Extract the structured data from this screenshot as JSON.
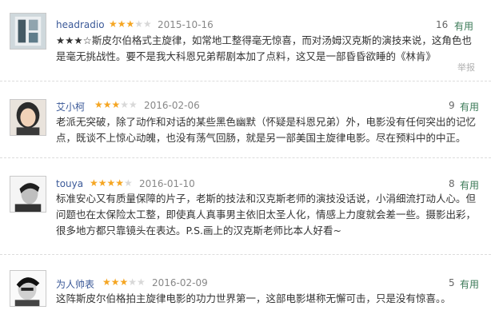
{
  "reviews": [
    {
      "username": "headradio",
      "rating": 3,
      "date": "2015-10-16",
      "votes": "16",
      "useful_label": "有用",
      "text": "★★★☆斯皮尔伯格式主旋律，如常地工整得毫无惊喜，而对汤姆汉克斯的演技来说，这角色也是毫无挑战性。要不是我大科恩兄弟帮剧本加了点料，这又是一部昏昏欲睡的《林肯》",
      "report_label": "举报"
    },
    {
      "username": "艾小柯",
      "rating": 3,
      "date": "2016-02-06",
      "votes": "9",
      "useful_label": "有用",
      "text": "老派无突破，除了动作和对话的某些黑色幽默（怀疑是科恩兄弟）外，电影没有任何突出的记忆点，既谈不上惊心动魄，也没有荡气回肠，就是另一部美国主旋律电影。尽在预料中的中正。"
    },
    {
      "username": "touya",
      "rating": 4,
      "date": "2016-01-10",
      "votes": "8",
      "useful_label": "有用",
      "text": "标准安心又有质量保障的片子，老斯的技法和汉克斯老师的演技没话说，小涓细流打动人心。但问题也在太保险太工整，即使真人真事男主依旧太圣人化，情感上力度就会差一些。摄影出彩，很多地方都只靠镜头在表达。P.S.画上的汉克斯老师比本人好看~"
    },
    {
      "username": "为人帅表",
      "rating": 3,
      "date": "2016-02-09",
      "votes": "5",
      "useful_label": "有用",
      "text": "这阵斯皮尔伯格拍主旋律电影的功力世界第一，这部电影堪称无懈可击，只是没有惊喜。。"
    }
  ]
}
